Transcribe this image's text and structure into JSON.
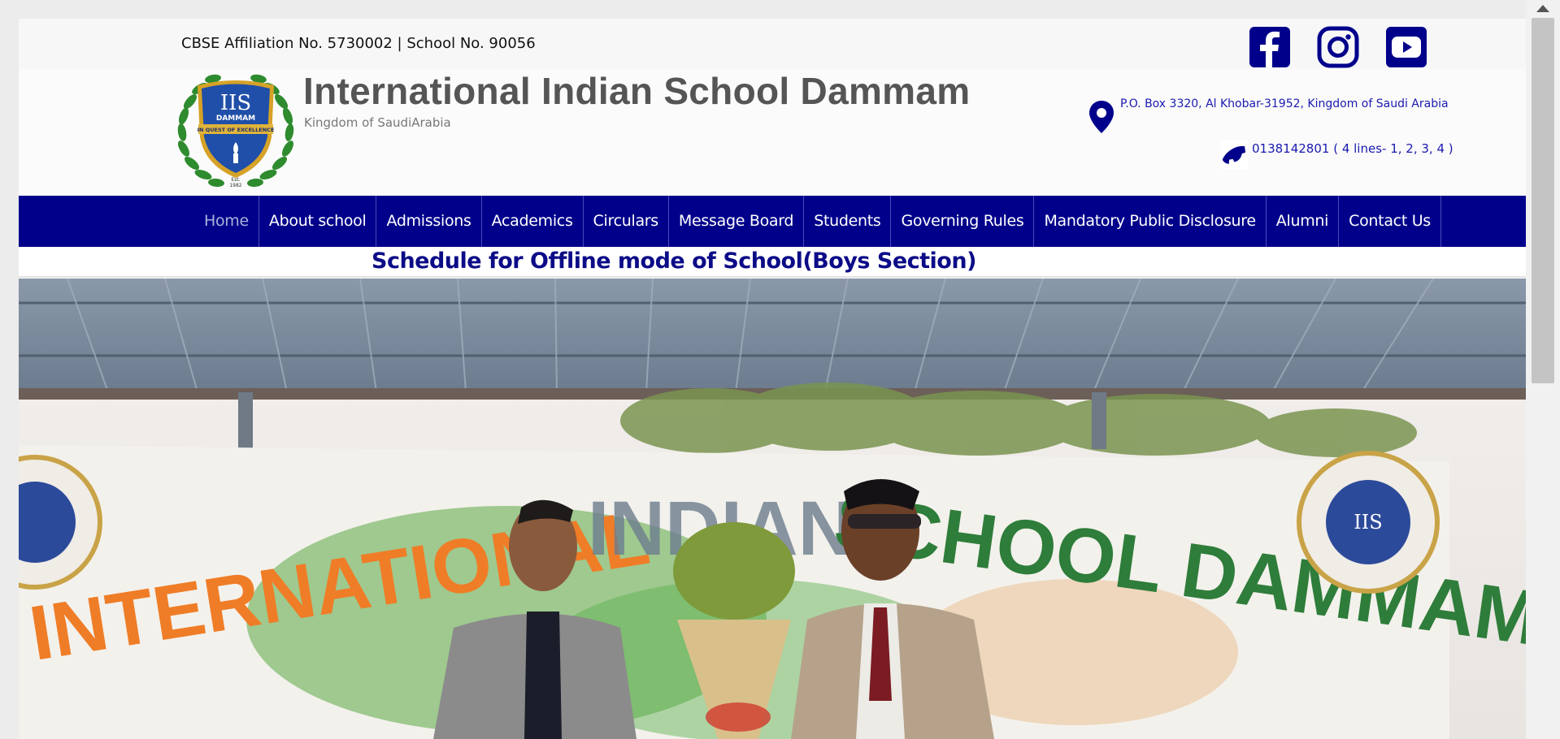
{
  "topbar": {
    "affiliation": "CBSE Affiliation No. 5730002 | School No. 90056",
    "social": [
      {
        "icon": "facebook-icon",
        "color": "#00008b"
      },
      {
        "icon": "instagram-icon",
        "color": "#00008b"
      },
      {
        "icon": "youtube-icon",
        "color": "#00008b"
      }
    ]
  },
  "header": {
    "logo": {
      "initials": "IIS",
      "city": "DAMMAM",
      "motto": "IN QUEST OF EXCELLENCE",
      "est": "Est.",
      "year": "1982"
    },
    "title": "International Indian School Dammam",
    "subtitle": "Kingdom of SaudiArabia",
    "address": "P.O. Box 3320, Al Khobar-31952, Kingdom of Saudi Arabia",
    "phone": "0138142801 ( 4 lines- 1, 2, 3, 4 )"
  },
  "nav": {
    "items": [
      {
        "label": "Home",
        "active": true
      },
      {
        "label": "About school"
      },
      {
        "label": "Admissions"
      },
      {
        "label": "Academics"
      },
      {
        "label": "Circulars"
      },
      {
        "label": "Message Board"
      },
      {
        "label": "Students"
      },
      {
        "label": "Governing Rules"
      },
      {
        "label": "Mandatory Public Disclosure"
      },
      {
        "label": "Alumni"
      },
      {
        "label": "Contact Us"
      }
    ]
  },
  "announcement": "Schedule for Offline mode of School(Boys Section)",
  "hero": {
    "banner_text_1": "INTERNATIONAL INDIAN SCHOOL DAMMAM",
    "banner_seal_text": "IIS"
  },
  "colors": {
    "nav_bg": "#00008b",
    "brand_blue": "#00008b",
    "title_gray": "#555555",
    "link_blue": "#1a1ab0"
  }
}
